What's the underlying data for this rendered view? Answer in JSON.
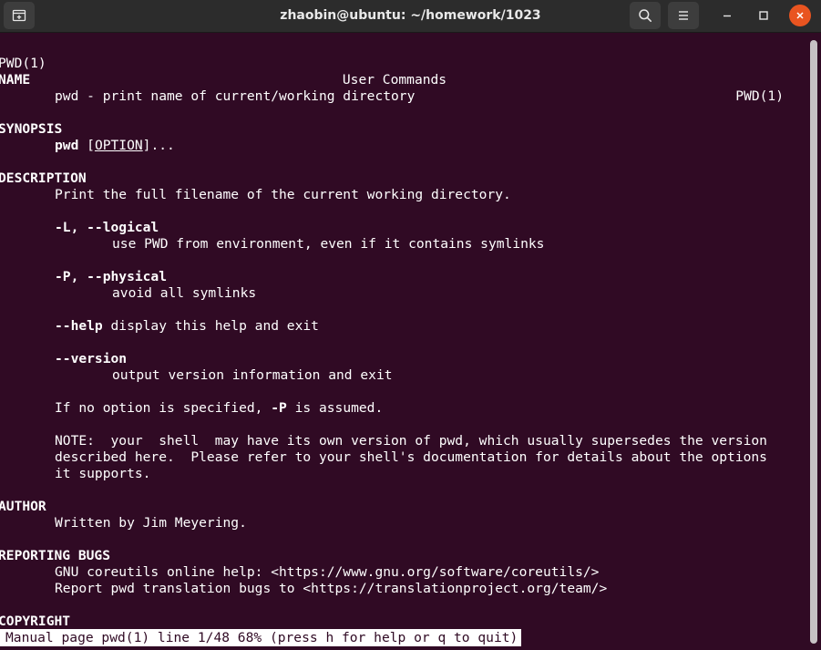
{
  "window": {
    "title": "zhaobin@ubuntu: ~/homework/1023"
  },
  "icons": {
    "new_tab": "new-tab-icon",
    "search": "search-icon",
    "menu": "hamburger-menu-icon",
    "minimize": "minimize-icon",
    "maximize": "maximize-icon",
    "close": "close-icon"
  },
  "colors": {
    "terminal_bg": "#300a24",
    "titlebar_bg": "#2c2c2c",
    "close_button": "#e95420",
    "text": "#ffffff"
  },
  "man": {
    "header_left": "PWD(1)",
    "header_center": "User Commands",
    "header_right": "PWD(1)",
    "name_heading": "NAME",
    "name_text": "pwd - print name of current/working directory",
    "synopsis_heading": "SYNOPSIS",
    "synopsis_cmd": "pwd",
    "synopsis_open": " [",
    "synopsis_option": "OPTION",
    "synopsis_close": "]...",
    "description_heading": "DESCRIPTION",
    "description_text": "Print the full filename of the current working directory.",
    "opt_logical": "-L, --logical",
    "opt_logical_desc": "use PWD from environment, even if it contains symlinks",
    "opt_physical": "-P, --physical",
    "opt_physical_desc": "avoid all symlinks",
    "opt_help": "--help",
    "opt_help_desc": " display this help and exit",
    "opt_version": "--version",
    "opt_version_desc": "output version information and exit",
    "default_pre": "If no option is specified, ",
    "default_opt": "-P",
    "default_post": " is assumed.",
    "note_line1": "NOTE:  your  shell  may have its own version of pwd, which usually supersedes the version",
    "note_line2": "described here.  Please refer to your shell's documentation for details about the options",
    "note_line3": "it supports.",
    "author_heading": "AUTHOR",
    "author_text": "Written by Jim Meyering.",
    "bugs_heading": "REPORTING BUGS",
    "bugs_line1": "GNU coreutils online help: <https://www.gnu.org/software/coreutils/>",
    "bugs_line2": "Report pwd translation bugs to <https://translationproject.org/team/>",
    "copyright_heading": "COPYRIGHT"
  },
  "status_line": "Manual page pwd(1) line 1/48 68% (press h for help or q to quit)"
}
